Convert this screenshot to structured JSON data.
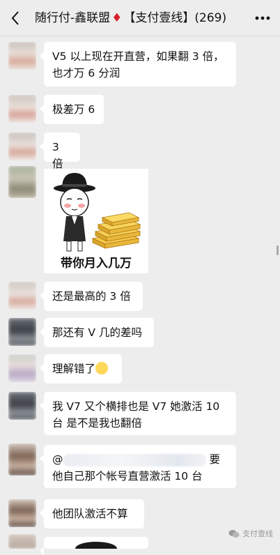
{
  "header": {
    "back_icon": "chevron-left-icon",
    "title_prefix": "随行付-鑫联盟",
    "title_symbol": "♦",
    "title_suffix": "【支付壹线】(269)",
    "more_icon": "more-dots-icon"
  },
  "messages": [
    {
      "type": "text",
      "lines": [
        "V5 以上现在开直营，如果翻 3 倍，",
        "也才万 6 分润"
      ]
    },
    {
      "type": "text",
      "lines": [
        "极差万 6"
      ]
    },
    {
      "type": "text",
      "lines": [
        "3 倍"
      ]
    },
    {
      "type": "sticker",
      "caption": "带你月入几万"
    },
    {
      "type": "text",
      "lines": [
        "还是最高的 3 倍"
      ]
    },
    {
      "type": "text",
      "lines": [
        "那还有 V 几的差吗"
      ]
    },
    {
      "type": "text",
      "lines": [
        "理解错了"
      ],
      "emoji": "crying-face-emoji"
    },
    {
      "type": "text",
      "lines": [
        "我 V7 又个横排也是 V7 她激活 10",
        "台 是不是我也翻倍"
      ]
    },
    {
      "type": "text",
      "lines": [
        "@",
        "要",
        "他自己那个帐号直营激活 10 台"
      ]
    },
    {
      "type": "text",
      "lines": [
        "他团队激活不算"
      ]
    }
  ],
  "watermark": {
    "text": "支付壹线",
    "icon": "wechat-official-icon"
  },
  "colors": {
    "background": "#ededed",
    "bubble": "#ffffff",
    "title_diamond": "#d81e2b"
  }
}
